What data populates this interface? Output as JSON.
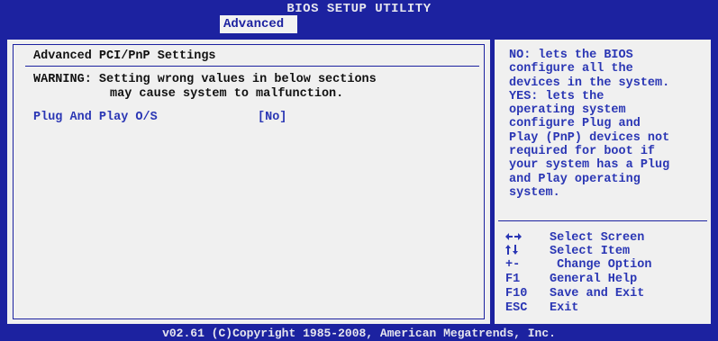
{
  "app": {
    "title": "BIOS SETUP UTILITY",
    "active_tab": "Advanced"
  },
  "left": {
    "section_title": "Advanced PCI/PnP Settings",
    "warning_line1": "WARNING: Setting wrong values in below sections",
    "warning_line2": "may cause system to malfunction.",
    "option": {
      "label": "Plug And Play O/S",
      "value": "[No]"
    }
  },
  "help": {
    "lines": [
      "NO: lets the BIOS",
      "configure all the",
      "devices in the system.",
      "YES: lets the",
      "operating system",
      "configure Plug and",
      "Play (PnP) devices not",
      "required for boot if",
      "your system has a Plug",
      "and Play operating",
      "system."
    ]
  },
  "keys": [
    {
      "key": "",
      "icon": "left-right-arrows-icon",
      "desc": "Select Screen"
    },
    {
      "key": "",
      "icon": "up-down-arrows-icon",
      "desc": "Select Item"
    },
    {
      "key": "+-",
      "icon": "",
      "desc": " Change Option"
    },
    {
      "key": "F1",
      "icon": "",
      "desc": "General Help"
    },
    {
      "key": "F10",
      "icon": "",
      "desc": "Save and Exit"
    },
    {
      "key": "ESC",
      "icon": "",
      "desc": "Exit"
    }
  ],
  "footer": {
    "copyright": "v02.61 (C)Copyright 1985-2008, American Megatrends, Inc."
  },
  "colors": {
    "frame_blue": "#1c22a0",
    "text_blue": "#2a36b4",
    "panel_bg": "#f0f0f0"
  }
}
